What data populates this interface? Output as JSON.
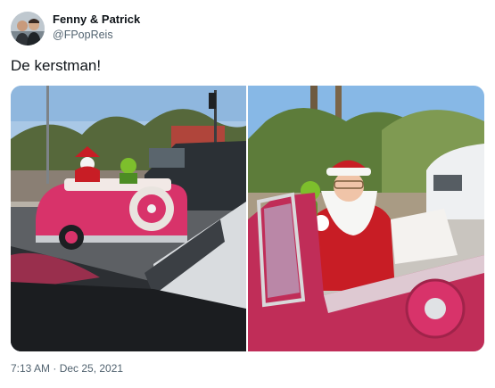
{
  "author": {
    "display_name": "Fenny & Patrick",
    "handle": "@FPopReis"
  },
  "tweet": {
    "text": "De kerstman!"
  },
  "media": {
    "photos": [
      {
        "subject": "pink convertible with Santa and Grinch at intersection"
      },
      {
        "subject": "Santa waving from pink convertible"
      }
    ]
  },
  "meta": {
    "timestamp": "7:13 AM · Dec 25, 2021"
  },
  "colors": {
    "car_pink": "#d8336a",
    "santa_red": "#c81d25",
    "grinch_green": "#7dbf2c",
    "text_secondary": "#536471"
  }
}
